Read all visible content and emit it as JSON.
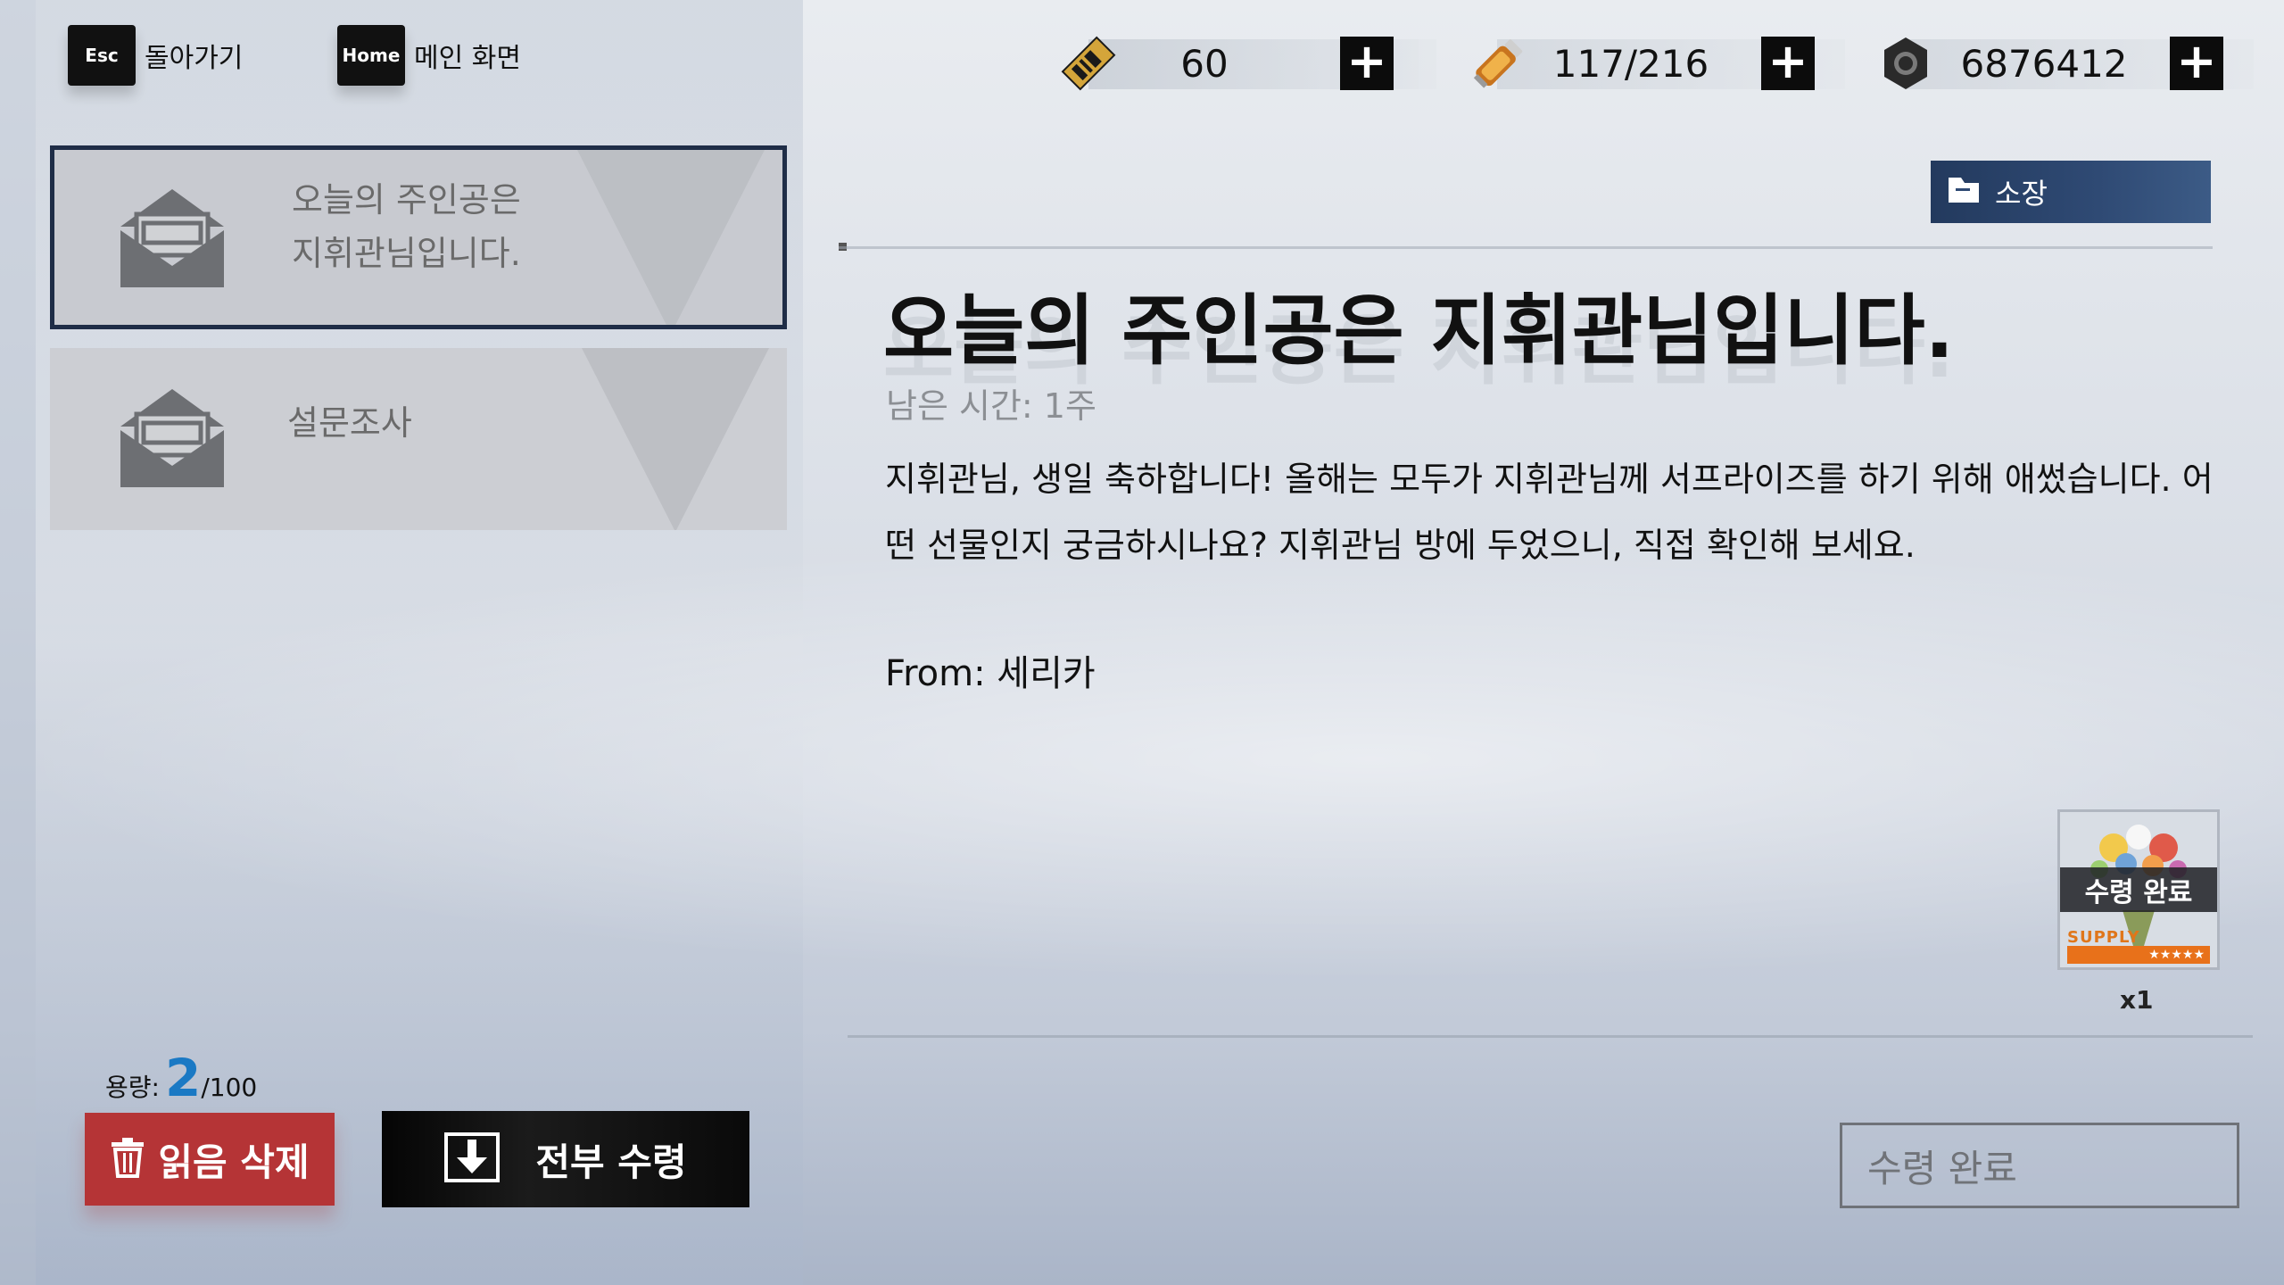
{
  "nav": {
    "back_key": "Esc",
    "back_label": "돌아가기",
    "home_key": "Home",
    "home_label": "메인 화면"
  },
  "resources": [
    {
      "icon": "ticket-icon",
      "value": "60"
    },
    {
      "icon": "battery-icon",
      "value": "117/216"
    },
    {
      "icon": "gear-nut-icon",
      "value": "6876412"
    }
  ],
  "mail_list": [
    {
      "title": "오늘의 주인공은\n지휘관님입니다.",
      "selected": true
    },
    {
      "title": "설문조사",
      "selected": false
    }
  ],
  "capacity": {
    "label": "용량:",
    "count": "2",
    "total": "/100"
  },
  "buttons": {
    "delete_read": "읽음 삭제",
    "claim_all": "전부 수령",
    "keep": "소장",
    "claimed": "수령 완료"
  },
  "mail": {
    "heading": "오늘의 주인공은 지휘관님입니다.",
    "remaining": "남은 시간: 1주",
    "body": "지휘관님, 생일 축하합니다! 올해는 모두가 지휘관님께 서프라이즈를 하기 위해 애썼습니다. 어떤 선물인지 궁금하시나요? 지휘관님 방에 두었으니, 직접 확인해 보세요.",
    "from": "From: 세리카"
  },
  "reward": {
    "status": "수령 완료",
    "tag": "SUPPLY",
    "stars": "★★★★★",
    "qty": "x1"
  },
  "colors": {
    "accent_blue": "#1a79c4",
    "delete_red": "#b53436",
    "selected_border": "#1f2d47",
    "keep_blue": "#2f4a74"
  }
}
